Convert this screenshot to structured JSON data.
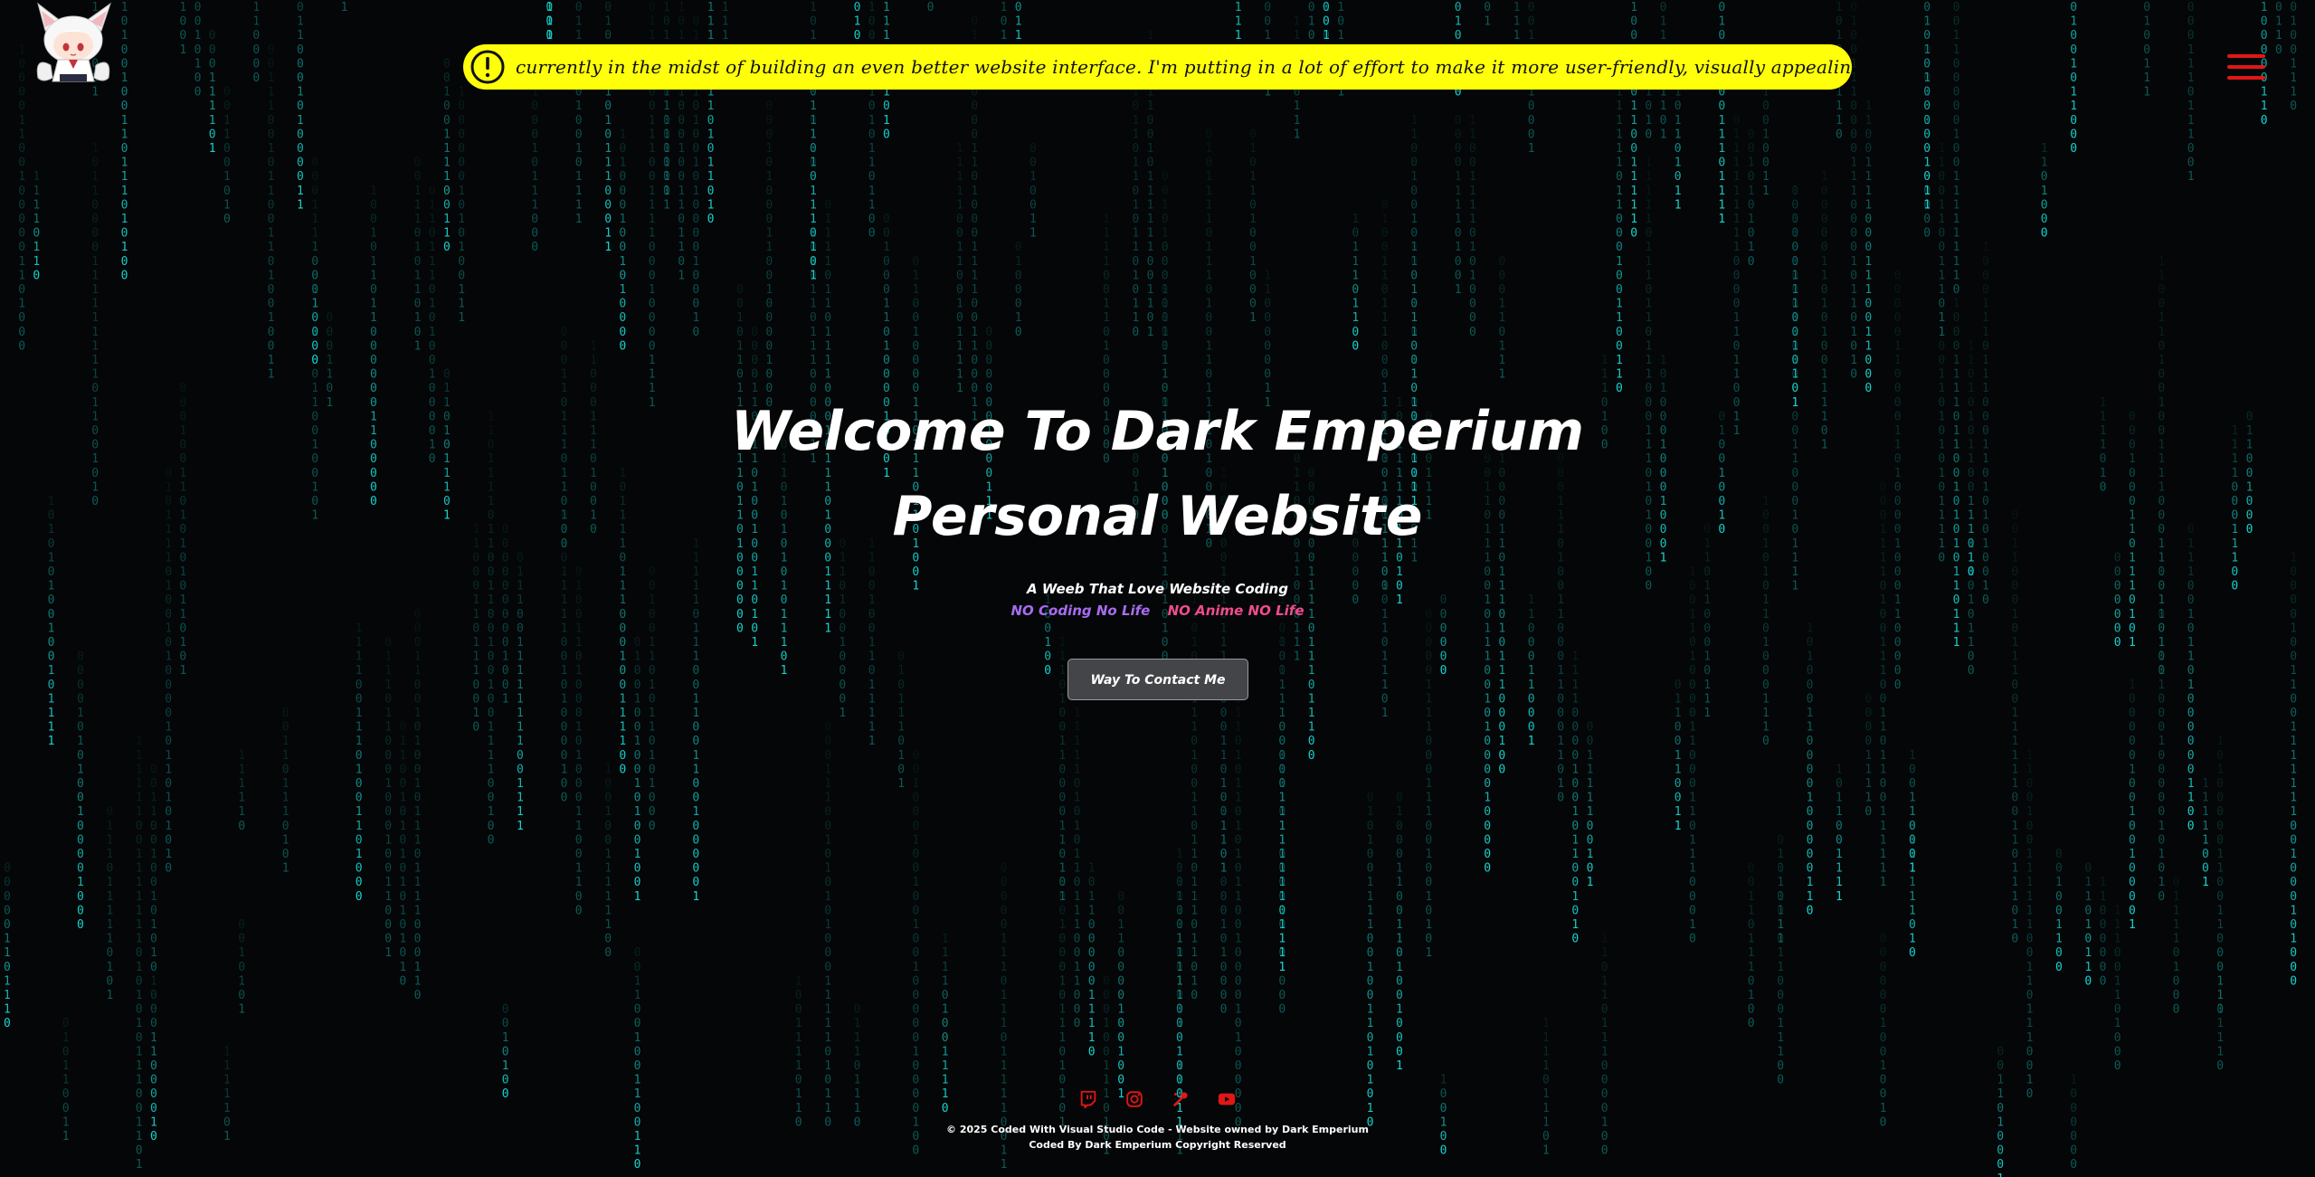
{
  "site": {
    "logo_icon": "anime-fox-girl-chibi-logo"
  },
  "notice": {
    "icon": "exclamation-circle-icon",
    "text": "currently in the midst of building an even better website interface. I'm putting in a lot of effort to make it more user-friendly, visually appealing, and feature-packed. I apolo",
    "background": "#ffff0a"
  },
  "menu": {
    "icon": "hamburger-menu-icon",
    "color": "#e01717"
  },
  "hero": {
    "title_line1": "Welcome To Dark Emperium",
    "title_line2": "Personal Website",
    "tagline": "A Weeb That Love Website Coding",
    "motto1": "NO Coding No Life",
    "motto2": "NO Anime NO Life",
    "motto1_color": "#a86cf0",
    "motto2_color": "#ee4d8f",
    "cta_label": "Way To Contact Me"
  },
  "socials": [
    {
      "name": "twitch-icon"
    },
    {
      "name": "instagram-icon"
    },
    {
      "name": "osu-icon"
    },
    {
      "name": "youtube-icon"
    }
  ],
  "social_color": "#e01717",
  "footer": {
    "line1": "© 2025 Coded With Visual Studio Code - Website owned by Dark Emperium",
    "line2": "Coded By Dark Emperium Copyright Reserved"
  },
  "background": {
    "effect": "binary-matrix-rain",
    "color": "#16d3cf",
    "glyphs": [
      "0",
      "1"
    ]
  }
}
